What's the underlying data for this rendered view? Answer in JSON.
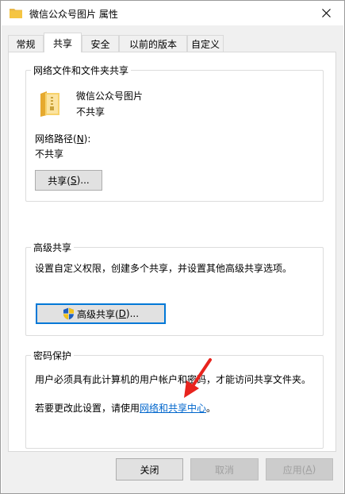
{
  "window": {
    "title": "微信公众号图片 属性"
  },
  "tabs": [
    {
      "label": "常规"
    },
    {
      "label": "共享"
    },
    {
      "label": "安全"
    },
    {
      "label": "以前的版本"
    },
    {
      "label": "自定义"
    }
  ],
  "active_tab_index": 1,
  "network_sharing": {
    "group_title": "网络文件和文件夹共享",
    "folder_name": "微信公众号图片",
    "folder_status": "不共享",
    "path_label_prefix": "网络路径(",
    "path_label_key": "N",
    "path_label_suffix": "):",
    "path_value": "不共享",
    "share_button_prefix": "共享(",
    "share_button_key": "S",
    "share_button_suffix": ")..."
  },
  "advanced_sharing": {
    "group_title": "高级共享",
    "description": "设置自定义权限，创建多个共享，并设置其他高级共享选项。",
    "button_prefix": "高级共享(",
    "button_key": "D",
    "button_suffix": ")..."
  },
  "password_protection": {
    "group_title": "密码保护",
    "description": "用户必须具有此计算机的用户帐户和密码，才能访问共享文件夹。",
    "change_prefix": "若要更改此设置，请使用",
    "link_text": "网络和共享中心",
    "change_suffix": "。"
  },
  "footer": {
    "close_label": "关闭",
    "cancel_label": "取消",
    "apply_prefix": "应用(",
    "apply_key": "A",
    "apply_suffix": ")"
  },
  "colors": {
    "accent": "#0078d7",
    "link": "#0066cc",
    "arrow": "#e8231d",
    "folder": "#f5c542"
  },
  "icons": {
    "title": "folder-icon",
    "folder": "folder-icon",
    "shield": "uac-shield-icon",
    "close": "close-icon"
  }
}
